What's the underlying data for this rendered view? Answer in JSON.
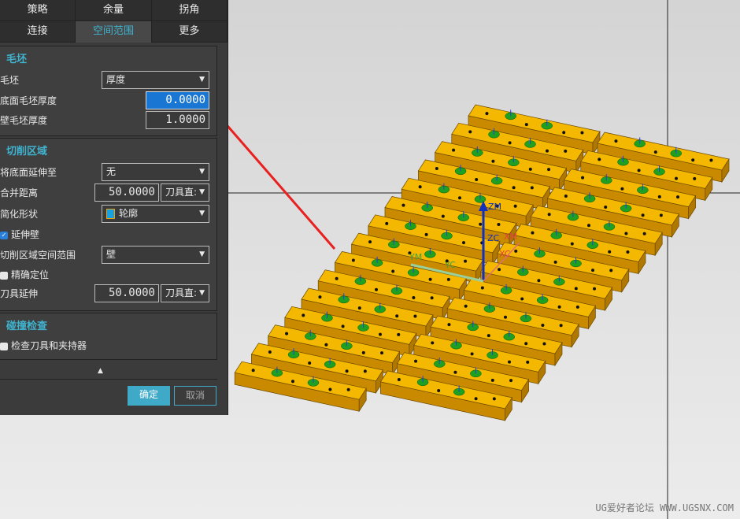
{
  "tabs_row1": [
    "策略",
    "余量",
    "拐角"
  ],
  "tabs_row2": [
    "连接",
    "空间范围",
    "更多"
  ],
  "active_tab": "空间范围",
  "blank": {
    "title": "毛坯",
    "blank_label": "毛坯",
    "blank_value": "厚度",
    "floor_label": "底面毛坯厚度",
    "floor_value": "0.0000",
    "wall_label": "壁毛坯厚度",
    "wall_value": "1.0000"
  },
  "cut_area": {
    "title": "切削区域",
    "extend_label": "将底面延伸至",
    "extend_value": "无",
    "merge_label": "合并距离",
    "merge_value": "50.0000",
    "merge_unit": "刀具直:",
    "simplify_label": "简化形状",
    "simplify_value": "轮廓",
    "extend_wall_label": "延伸壁",
    "extend_wall_checked": true,
    "space_label": "切削区域空间范围",
    "space_value": "壁",
    "precise_label": "精确定位",
    "precise_checked": false,
    "tool_ext_label": "刀具延伸",
    "tool_ext_value": "50.0000",
    "tool_ext_unit": "刀具直:"
  },
  "collision": {
    "title": "碰撞检查",
    "check_label": "检查刀具和夹持器",
    "check_checked": false
  },
  "buttons": {
    "ok": "确定",
    "cancel": "取消"
  },
  "axes": {
    "zm": "ZM",
    "zc": "ZC",
    "xm": "XM",
    "xc": "XC",
    "ym": "YM",
    "yc": "YC"
  },
  "watermark": "UG爱好者论坛 WWW.UGSNX.COM",
  "colors": {
    "accent": "#3fb3cf",
    "part_top": "#f5b800",
    "part_side": "#c98a00",
    "arrow": "#e82020"
  }
}
